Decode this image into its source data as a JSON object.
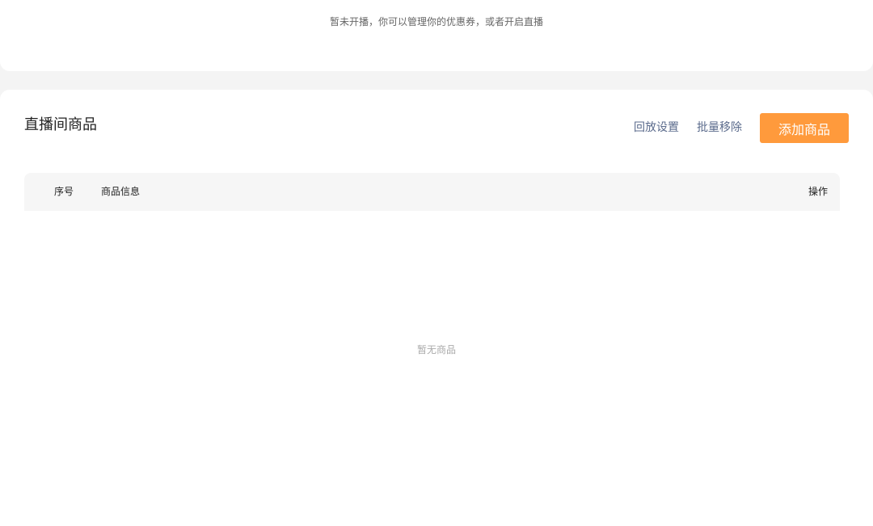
{
  "top_notice": "暂未开播，你可以管理你的优惠券，或者开启直播",
  "goods_section": {
    "title": "直播间商品",
    "actions": {
      "replay_settings": "回放设置",
      "batch_remove": "批量移除",
      "add_goods": "添加商品"
    },
    "table": {
      "columns": {
        "index": "序号",
        "info": "商品信息",
        "operations": "操作"
      }
    },
    "empty_text": "暂无商品"
  },
  "colors": {
    "primary": "#ff9a3c",
    "link": "#5b6b8c",
    "page_bg": "#f4f4f4"
  }
}
